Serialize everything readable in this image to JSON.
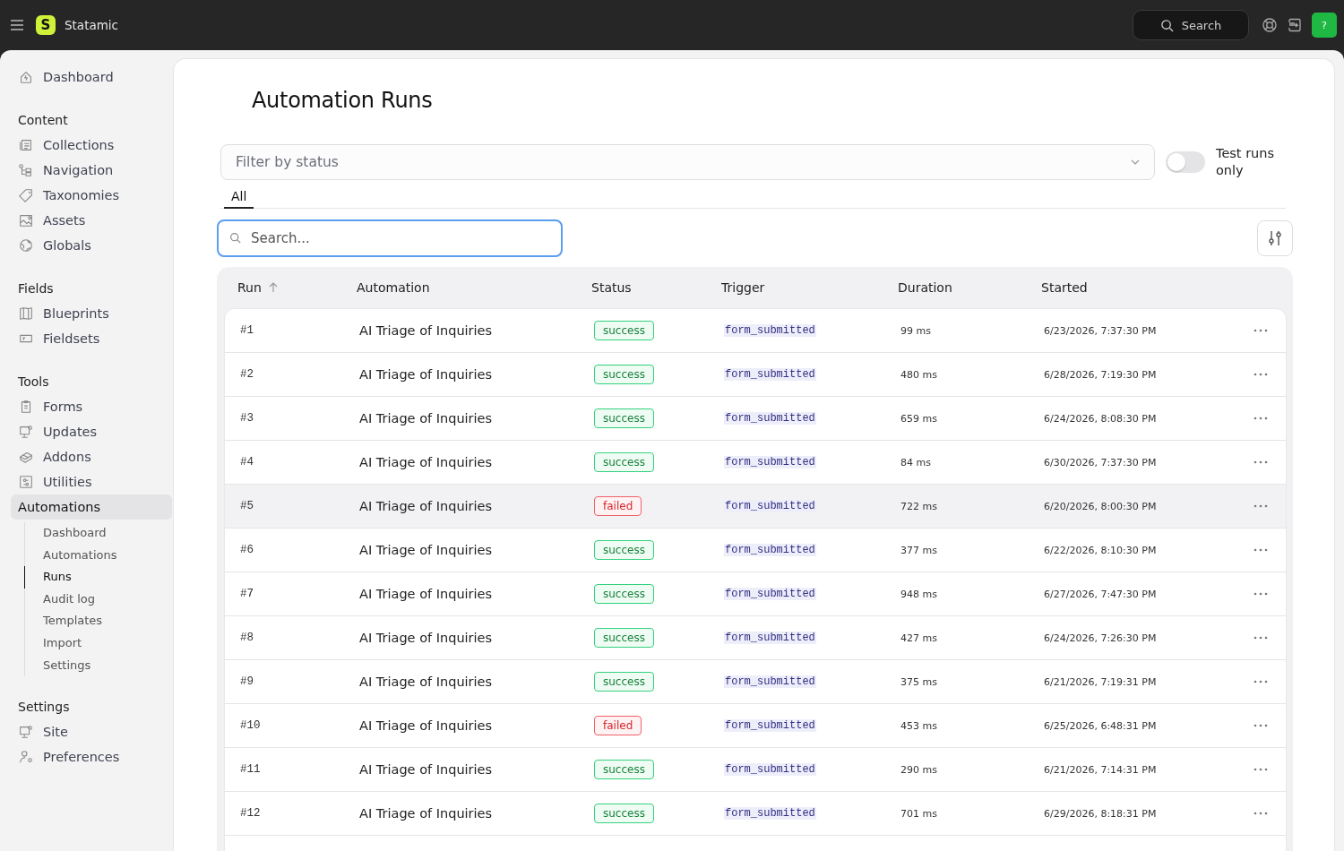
{
  "topbar": {
    "brand": {
      "logo_letter": "S",
      "name": "Statamic"
    },
    "search": {
      "placeholder": "Search"
    },
    "avatar": "?"
  },
  "sidebar": {
    "top": [
      {
        "label": "Dashboard",
        "selected": false
      }
    ],
    "sections": [
      {
        "title": "Content",
        "items": [
          {
            "label": "Collections",
            "selected": false
          },
          {
            "label": "Navigation",
            "selected": false
          },
          {
            "label": "Taxonomies",
            "selected": false
          },
          {
            "label": "Assets",
            "selected": false
          },
          {
            "label": "Globals",
            "selected": false
          }
        ]
      },
      {
        "title": "Fields",
        "items": [
          {
            "label": "Blueprints",
            "selected": false
          },
          {
            "label": "Fieldsets",
            "selected": false
          }
        ]
      },
      {
        "title": "Tools",
        "items": [
          {
            "label": "Forms",
            "selected": false
          },
          {
            "label": "Updates",
            "selected": false
          },
          {
            "label": "Addons",
            "selected": false
          },
          {
            "label": "Utilities",
            "selected": false
          },
          {
            "label": "Automations",
            "selected": true,
            "children": [
              {
                "label": "Dashboard",
                "selected": false
              },
              {
                "label": "Automations",
                "selected": false
              },
              {
                "label": "Runs",
                "selected": true
              },
              {
                "label": "Audit log",
                "selected": false
              },
              {
                "label": "Templates",
                "selected": false
              },
              {
                "label": "Import",
                "selected": false
              },
              {
                "label": "Settings",
                "selected": false
              }
            ]
          }
        ]
      },
      {
        "title": "Settings",
        "items": [
          {
            "label": "Site",
            "selected": false
          },
          {
            "label": "Preferences",
            "selected": false
          }
        ]
      }
    ]
  },
  "page": {
    "title": "Automation Runs",
    "filter": {
      "placeholder": "Filter by status"
    },
    "toggle": {
      "label": "Test runs only",
      "on": false
    },
    "tabs": [
      {
        "label": "All",
        "selected": true
      }
    ],
    "search": {
      "placeholder": "Search..."
    },
    "table": {
      "columns": [
        {
          "label": "Run",
          "sorted": true
        },
        {
          "label": "Automation",
          "sorted": false
        },
        {
          "label": "Status",
          "sorted": false
        },
        {
          "label": "Trigger",
          "sorted": false
        },
        {
          "label": "Duration",
          "sorted": false
        },
        {
          "label": "Started",
          "sorted": false
        }
      ],
      "rows": [
        {
          "run": "#1",
          "automation": "AI Triage of Inquiries",
          "status": {
            "label": "success",
            "kind": "success"
          },
          "trigger": "form_submitted",
          "duration": "99 ms",
          "started": "6/23/2026, 7:37:30 PM",
          "highlighted": false
        },
        {
          "run": "#2",
          "automation": "AI Triage of Inquiries",
          "status": {
            "label": "success",
            "kind": "success"
          },
          "trigger": "form_submitted",
          "duration": "480 ms",
          "started": "6/28/2026, 7:19:30 PM",
          "highlighted": false
        },
        {
          "run": "#3",
          "automation": "AI Triage of Inquiries",
          "status": {
            "label": "success",
            "kind": "success"
          },
          "trigger": "form_submitted",
          "duration": "659 ms",
          "started": "6/24/2026, 8:08:30 PM",
          "highlighted": false
        },
        {
          "run": "#4",
          "automation": "AI Triage of Inquiries",
          "status": {
            "label": "success",
            "kind": "success"
          },
          "trigger": "form_submitted",
          "duration": "84 ms",
          "started": "6/30/2026, 7:37:30 PM",
          "highlighted": false
        },
        {
          "run": "#5",
          "automation": "AI Triage of Inquiries",
          "status": {
            "label": "failed",
            "kind": "failed"
          },
          "trigger": "form_submitted",
          "duration": "722 ms",
          "started": "6/20/2026, 8:00:30 PM",
          "highlighted": true
        },
        {
          "run": "#6",
          "automation": "AI Triage of Inquiries",
          "status": {
            "label": "success",
            "kind": "success"
          },
          "trigger": "form_submitted",
          "duration": "377 ms",
          "started": "6/22/2026, 8:10:30 PM",
          "highlighted": false
        },
        {
          "run": "#7",
          "automation": "AI Triage of Inquiries",
          "status": {
            "label": "success",
            "kind": "success"
          },
          "trigger": "form_submitted",
          "duration": "948 ms",
          "started": "6/27/2026, 7:47:30 PM",
          "highlighted": false
        },
        {
          "run": "#8",
          "automation": "AI Triage of Inquiries",
          "status": {
            "label": "success",
            "kind": "success"
          },
          "trigger": "form_submitted",
          "duration": "427 ms",
          "started": "6/24/2026, 7:26:30 PM",
          "highlighted": false
        },
        {
          "run": "#9",
          "automation": "AI Triage of Inquiries",
          "status": {
            "label": "success",
            "kind": "success"
          },
          "trigger": "form_submitted",
          "duration": "375 ms",
          "started": "6/21/2026, 7:19:31 PM",
          "highlighted": false
        },
        {
          "run": "#10",
          "automation": "AI Triage of Inquiries",
          "status": {
            "label": "failed",
            "kind": "failed"
          },
          "trigger": "form_submitted",
          "duration": "453 ms",
          "started": "6/25/2026, 6:48:31 PM",
          "highlighted": false
        },
        {
          "run": "#11",
          "automation": "AI Triage of Inquiries",
          "status": {
            "label": "success",
            "kind": "success"
          },
          "trigger": "form_submitted",
          "duration": "290 ms",
          "started": "6/21/2026, 7:14:31 PM",
          "highlighted": false
        },
        {
          "run": "#12",
          "automation": "AI Triage of Inquiries",
          "status": {
            "label": "success",
            "kind": "success"
          },
          "trigger": "form_submitted",
          "duration": "701 ms",
          "started": "6/29/2026, 8:18:31 PM",
          "highlighted": false
        }
      ]
    }
  }
}
